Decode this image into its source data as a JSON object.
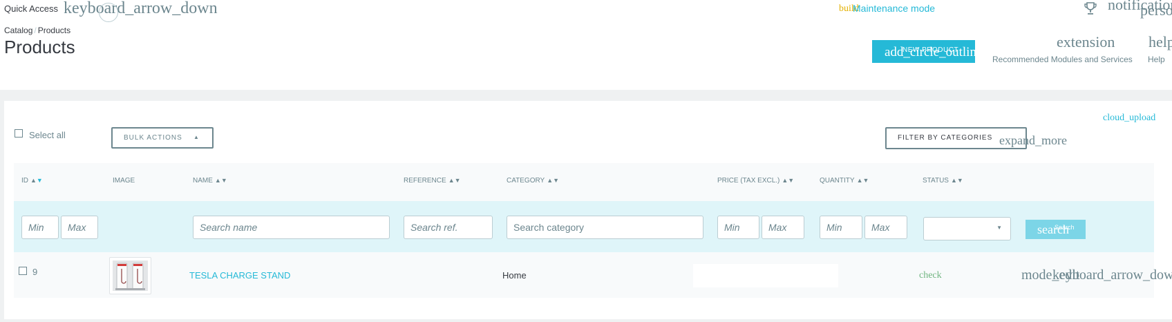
{
  "header": {
    "quick_access_label": "Quick Access",
    "quick_access_icon": "keyboard_arrow_down",
    "build_icon": "build",
    "maintenance_label": "Maintenance mode",
    "notifications_icon": "notifications",
    "person_icon": "person",
    "breadcrumb": [
      "Catalog",
      "Products"
    ],
    "page_title": "Products",
    "new_product_label": "NEW PRODUCT",
    "new_product_icon": "add_circle_outline",
    "extension_icon": "extension",
    "extension_label": "Recommended Modules and Services",
    "help_icon": "help",
    "help_label": "Help"
  },
  "toolbar": {
    "cloud_icon": "cloud_upload",
    "select_all_label": "Select all",
    "bulk_actions_label": "BULK ACTIONS",
    "filter_categories_label": "FILTER BY CATEGORIES",
    "expand_icon": "expand_more"
  },
  "table": {
    "columns": [
      {
        "label": "ID"
      },
      {
        "label": "IMAGE"
      },
      {
        "label": "NAME"
      },
      {
        "label": "REFERENCE"
      },
      {
        "label": "CATEGORY"
      },
      {
        "label": "PRICE (TAX EXCL.)"
      },
      {
        "label": "QUANTITY"
      },
      {
        "label": "STATUS"
      }
    ],
    "filters": {
      "id_min": "Min",
      "id_max": "Max",
      "name": "Search name",
      "reference": "Search ref.",
      "category": "Search category",
      "price_min": "Min",
      "price_max": "Max",
      "qty_min": "Min",
      "qty_max": "Max",
      "status_value": "",
      "search_icon": "search",
      "search_label": "Search"
    },
    "rows": [
      {
        "id": "9",
        "name": "TESLA CHARGE STAND",
        "category": "Home",
        "status_icon": "check",
        "actions_icon": "mode_edit",
        "actions_menu_icon": "keyboard_arrow_down"
      }
    ]
  },
  "colors": {
    "accent": "#25b9d7",
    "text": "#363a41",
    "muted": "#6c868e",
    "filter_bg": "#dff5f9",
    "success": "#70b580",
    "build": "#e3b000"
  }
}
